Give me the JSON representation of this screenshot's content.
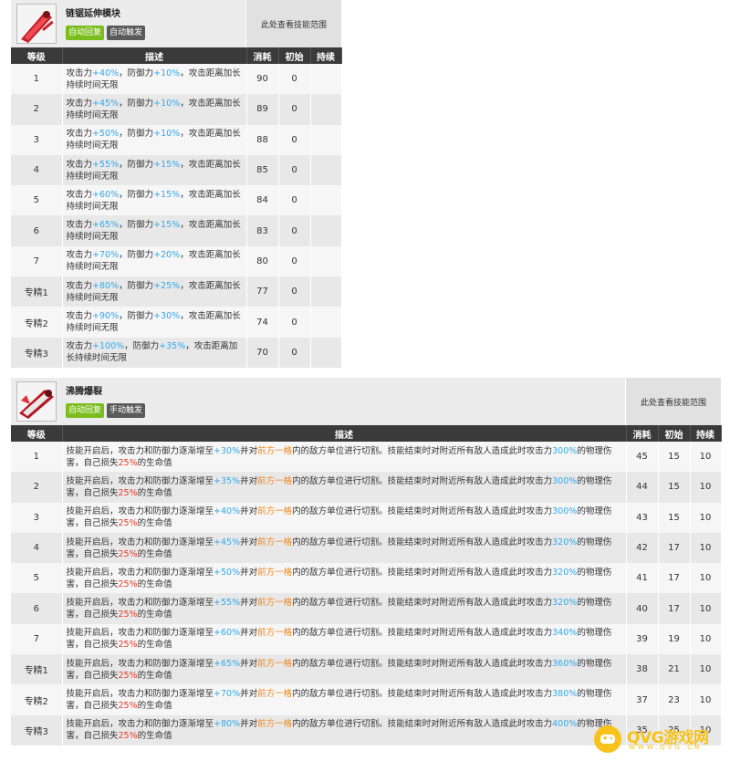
{
  "skill1": {
    "name": "链锯延伸模块",
    "tag_auto": "自动回复",
    "tag_trigger": "自动触发",
    "range_label": "此处查看技能范围",
    "headers": [
      "等级",
      "描述",
      "消耗",
      "初始",
      "持续"
    ],
    "rows": [
      {
        "level": "1",
        "d1": "攻击力",
        "v1": "+40%",
        "d2": "，防御力",
        "v2": "+10%",
        "d3": "，攻击距离加长持续时间无限",
        "cost": "90",
        "init": "0",
        "dur": ""
      },
      {
        "level": "2",
        "d1": "攻击力",
        "v1": "+45%",
        "d2": "，防御力",
        "v2": "+10%",
        "d3": "，攻击距离加长持续时间无限",
        "cost": "89",
        "init": "0",
        "dur": ""
      },
      {
        "level": "3",
        "d1": "攻击力",
        "v1": "+50%",
        "d2": "，防御力",
        "v2": "+10%",
        "d3": "，攻击距离加长持续时间无限",
        "cost": "88",
        "init": "0",
        "dur": ""
      },
      {
        "level": "4",
        "d1": "攻击力",
        "v1": "+55%",
        "d2": "，防御力",
        "v2": "+15%",
        "d3": "，攻击距离加长持续时间无限",
        "cost": "85",
        "init": "0",
        "dur": ""
      },
      {
        "level": "5",
        "d1": "攻击力",
        "v1": "+60%",
        "d2": "，防御力",
        "v2": "+15%",
        "d3": "，攻击距离加长持续时间无限",
        "cost": "84",
        "init": "0",
        "dur": ""
      },
      {
        "level": "6",
        "d1": "攻击力",
        "v1": "+65%",
        "d2": "，防御力",
        "v2": "+15%",
        "d3": "，攻击距离加长持续时间无限",
        "cost": "83",
        "init": "0",
        "dur": ""
      },
      {
        "level": "7",
        "d1": "攻击力",
        "v1": "+70%",
        "d2": "，防御力",
        "v2": "+20%",
        "d3": "，攻击距离加长持续时间无限",
        "cost": "80",
        "init": "0",
        "dur": ""
      },
      {
        "level": "专精1",
        "d1": "攻击力",
        "v1": "+80%",
        "d2": "，防御力",
        "v2": "+25%",
        "d3": "，攻击距离加长持续时间无限",
        "cost": "77",
        "init": "0",
        "dur": ""
      },
      {
        "level": "专精2",
        "d1": "攻击力",
        "v1": "+90%",
        "d2": "，防御力",
        "v2": "+30%",
        "d3": "，攻击距离加长持续时间无限",
        "cost": "74",
        "init": "0",
        "dur": ""
      },
      {
        "level": "专精3",
        "d1": "攻击力",
        "v1": "+100%",
        "d2": "，防御力",
        "v2": "+35%",
        "d3": "，攻击距离加长持续时间无限",
        "cost": "70",
        "init": "0",
        "dur": ""
      }
    ]
  },
  "skill2": {
    "name": "沸腾爆裂",
    "tag_auto": "自动回复",
    "tag_trigger": "手动触发",
    "range_label": "此处查看技能范围",
    "headers": [
      "等级",
      "描述",
      "消耗",
      "初始",
      "持续"
    ],
    "rows": [
      {
        "level": "1",
        "p1": "技能开启后，攻击力和防御力逐渐增至",
        "v1": "+30%",
        "p2": "并对",
        "area": "前方一格",
        "p3": "内的敌方单位进行切割。技能结束时对附近所有敌人造成此时攻击力",
        "v2": "300%",
        "p4": "的物理伤害，自己损失",
        "v3": "25%",
        "p5": "的生命值",
        "cost": "45",
        "init": "15",
        "dur": "10"
      },
      {
        "level": "2",
        "p1": "技能开启后，攻击力和防御力逐渐增至",
        "v1": "+35%",
        "p2": "并对",
        "area": "前方一格",
        "p3": "内的敌方单位进行切割。技能结束时对附近所有敌人造成此时攻击力",
        "v2": "300%",
        "p4": "的物理伤害，自己损失",
        "v3": "25%",
        "p5": "的生命值",
        "cost": "44",
        "init": "15",
        "dur": "10"
      },
      {
        "level": "3",
        "p1": "技能开启后，攻击力和防御力逐渐增至",
        "v1": "+40%",
        "p2": "并对",
        "area": "前方一格",
        "p3": "内的敌方单位进行切割。技能结束时对附近所有敌人造成此时攻击力",
        "v2": "300%",
        "p4": "的物理伤害，自己损失",
        "v3": "25%",
        "p5": "的生命值",
        "cost": "43",
        "init": "15",
        "dur": "10"
      },
      {
        "level": "4",
        "p1": "技能开启后，攻击力和防御力逐渐增至",
        "v1": "+45%",
        "p2": "并对",
        "area": "前方一格",
        "p3": "内的敌方单位进行切割。技能结束时对附近所有敌人造成此时攻击力",
        "v2": "320%",
        "p4": "的物理伤害，自己损失",
        "v3": "25%",
        "p5": "的生命值",
        "cost": "42",
        "init": "17",
        "dur": "10"
      },
      {
        "level": "5",
        "p1": "技能开启后，攻击力和防御力逐渐增至",
        "v1": "+50%",
        "p2": "并对",
        "area": "前方一格",
        "p3": "内的敌方单位进行切割。技能结束时对附近所有敌人造成此时攻击力",
        "v2": "320%",
        "p4": "的物理伤害，自己损失",
        "v3": "25%",
        "p5": "的生命值",
        "cost": "41",
        "init": "17",
        "dur": "10"
      },
      {
        "level": "6",
        "p1": "技能开启后，攻击力和防御力逐渐增至",
        "v1": "+55%",
        "p2": "并对",
        "area": "前方一格",
        "p3": "内的敌方单位进行切割。技能结束时对附近所有敌人造成此时攻击力",
        "v2": "320%",
        "p4": "的物理伤害，自己损失",
        "v3": "25%",
        "p5": "的生命值",
        "cost": "40",
        "init": "17",
        "dur": "10"
      },
      {
        "level": "7",
        "p1": "技能开启后，攻击力和防御力逐渐增至",
        "v1": "+60%",
        "p2": "并对",
        "area": "前方一格",
        "p3": "内的敌方单位进行切割。技能结束时对附近所有敌人造成此时攻击力",
        "v2": "340%",
        "p4": "的物理伤害，自己损失",
        "v3": "25%",
        "p5": "的生命值",
        "cost": "39",
        "init": "19",
        "dur": "10"
      },
      {
        "level": "专精1",
        "p1": "技能开启后，攻击力和防御力逐渐增至",
        "v1": "+65%",
        "p2": "并对",
        "area": "前方一格",
        "p3": "内的敌方单位进行切割。技能结束时对附近所有敌人造成此时攻击力",
        "v2": "360%",
        "p4": "的物理伤害，自己损失",
        "v3": "25%",
        "p5": "的生命值",
        "cost": "38",
        "init": "21",
        "dur": "10"
      },
      {
        "level": "专精2",
        "p1": "技能开启后，攻击力和防御力逐渐增至",
        "v1": "+70%",
        "p2": "并对",
        "area": "前方一格",
        "p3": "内的敌方单位进行切割。技能结束时对附近所有敌人造成此时攻击力",
        "v2": "380%",
        "p4": "的物理伤害，自己损失",
        "v3": "25%",
        "p5": "的生命值",
        "cost": "37",
        "init": "23",
        "dur": "10"
      },
      {
        "level": "专精3",
        "p1": "技能开启后，攻击力和防御力逐渐增至",
        "v1": "+80%",
        "p2": "并对",
        "area": "前方一格",
        "p3": "内的敌方单位进行切割。技能结束时对附近所有敌人造成此时攻击力",
        "v2": "400%",
        "p4": "的物理伤害，自己损失",
        "v3": "25%",
        "p5": "的生命值",
        "cost": "35",
        "init": "25",
        "dur": "10"
      }
    ]
  },
  "watermark": {
    "title": "QVG游戏网",
    "sub": "WWW.QVG.CN"
  },
  "colors": {
    "buff_blue": "#33a9ea",
    "area_orange": "#f0841b",
    "hp_red": "#e53d2a",
    "tag_green": "#7cbd1e",
    "header_dark": "#3a3a3a"
  }
}
